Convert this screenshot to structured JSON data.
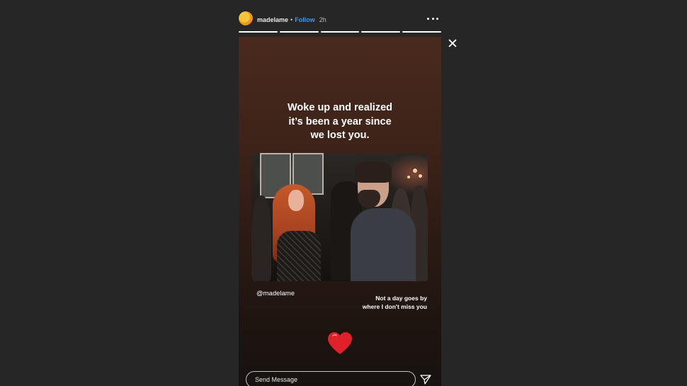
{
  "header": {
    "username": "madelame",
    "separator": "•",
    "follow_label": "Follow",
    "time": "2h"
  },
  "progress": {
    "total_segments": 5,
    "completed_segments": 5
  },
  "icons": {
    "more": "more-options-icon",
    "close": "close-icon",
    "heart": "heart-icon",
    "send": "send-icon"
  },
  "story": {
    "headline": "Woke up and realized\nit’s been a year since\nwe lost you.",
    "mention": "@madelame",
    "caption": "Not a day goes by\nwhere I don't miss you"
  },
  "reply": {
    "placeholder": "Send Message"
  },
  "colors": {
    "background": "#262626",
    "follow": "#3897f0",
    "heart": "#e0202a"
  }
}
